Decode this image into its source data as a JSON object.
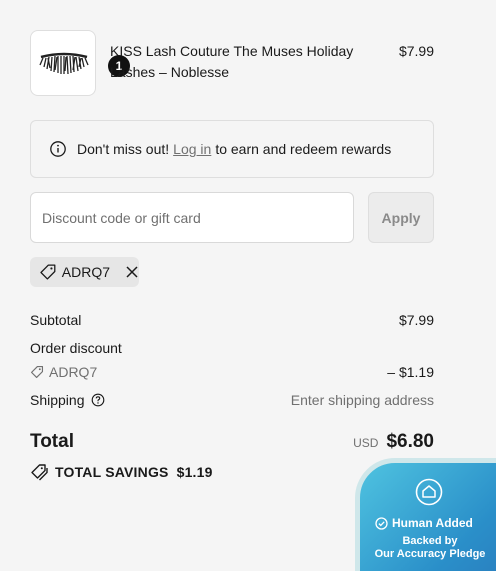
{
  "product": {
    "quantity": "1",
    "name": "KISS Lash Couture The Muses Holiday Lashes – Noblesse",
    "price": "$7.99",
    "image_icon": "eyelash-icon"
  },
  "rewards": {
    "text_before": "Don't miss out!",
    "link": "Log in",
    "text_after": "to earn and redeem rewards",
    "icon": "info-icon"
  },
  "discount": {
    "placeholder": "Discount code or gift card",
    "value": "",
    "apply_label": "Apply",
    "applied_code": "ADRQ7"
  },
  "summary": {
    "subtotal_label": "Subtotal",
    "subtotal_value": "$7.99",
    "order_discount_label": "Order discount",
    "discount_code": "ADRQ7",
    "discount_value": "– $1.19",
    "shipping_label": "Shipping",
    "shipping_value": "Enter shipping address",
    "total_label": "Total",
    "currency": "USD",
    "total_value": "$6.80",
    "savings_label": "TOTAL SAVINGS",
    "savings_value": "$1.19"
  },
  "pledge": {
    "title": "Human Added",
    "line1": "Backed by",
    "line2": "Our Accuracy Pledge"
  },
  "colors": {
    "background": "#f5f5f5",
    "pledge_gradient_start": "#4fc3e0",
    "pledge_gradient_end": "#2a7fbf"
  }
}
